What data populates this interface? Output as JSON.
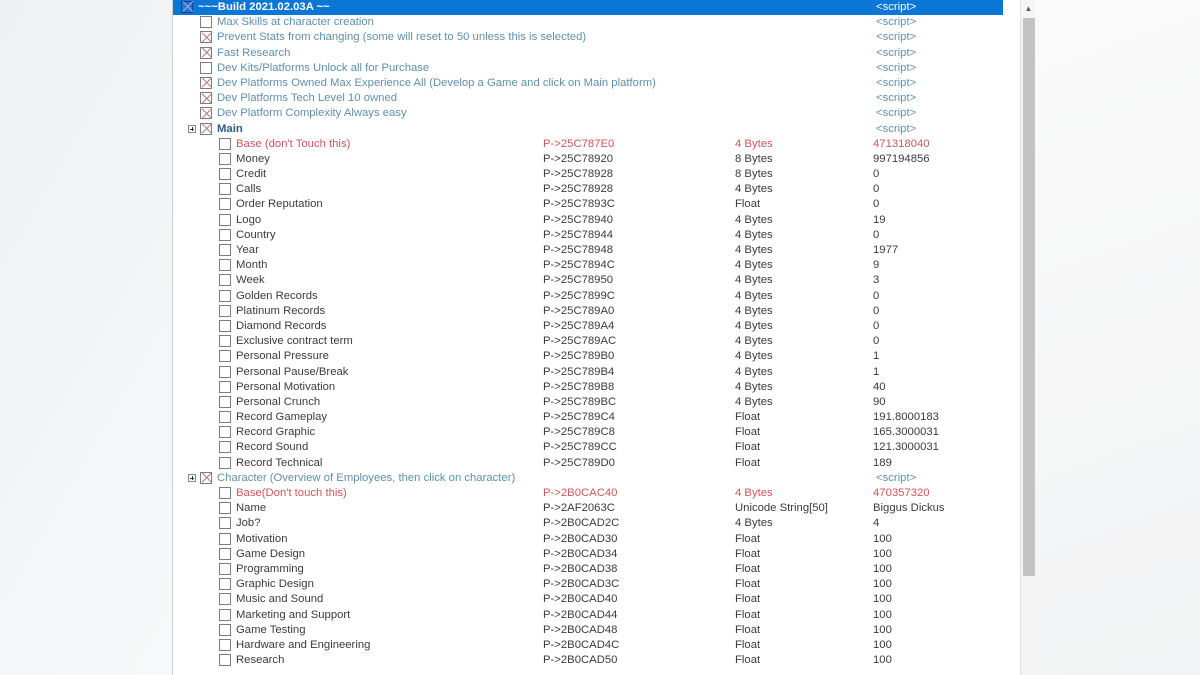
{
  "window": {
    "title": "Cheat Engine cheat table",
    "accent": "#0a76d6",
    "warn_color": "#d0555b",
    "desc_color": "#5f8fae"
  },
  "scrollbar": {
    "up_arrow_icon": "scroll-up-arrow",
    "up_arrow_glyph": "▲"
  },
  "table": {
    "script_cell_label": "<script>",
    "rows": [
      {
        "indent": 0,
        "expander": false,
        "checkbox": "checked",
        "selected": true,
        "desc": "~~~Build 2021.02.03A ~~",
        "style": "hdr-bold",
        "address": "",
        "type": "",
        "value": "",
        "script": "<script>"
      },
      {
        "indent": 1,
        "expander": false,
        "checkbox": "empty",
        "selected": false,
        "desc": "Max Skills at character creation",
        "style": "link",
        "address": "",
        "type": "",
        "value": "",
        "script": "<script>"
      },
      {
        "indent": 1,
        "expander": false,
        "checkbox": "checked",
        "selected": false,
        "desc": "Prevent Stats from changing (some will reset to 50 unless this is selected)",
        "style": "link",
        "address": "",
        "type": "",
        "value": "",
        "script": "<script>"
      },
      {
        "indent": 1,
        "expander": false,
        "checkbox": "checked",
        "selected": false,
        "desc": "Fast Research",
        "style": "link",
        "address": "",
        "type": "",
        "value": "",
        "script": "<script>"
      },
      {
        "indent": 1,
        "expander": false,
        "checkbox": "empty",
        "selected": false,
        "desc": "Dev Kits/Platforms Unlock all for Purchase",
        "style": "link",
        "address": "",
        "type": "",
        "value": "",
        "script": "<script>"
      },
      {
        "indent": 1,
        "expander": false,
        "checkbox": "checked",
        "selected": false,
        "desc": "Dev Platforms Owned Max Experience All  (Develop a Game and click on Main platform)",
        "style": "link",
        "address": "",
        "type": "",
        "value": "",
        "script": "<script>"
      },
      {
        "indent": 1,
        "expander": false,
        "checkbox": "checked",
        "selected": false,
        "desc": "Dev Platforms Tech Level 10 owned",
        "style": "link",
        "address": "",
        "type": "",
        "value": "",
        "script": "<script>"
      },
      {
        "indent": 1,
        "expander": false,
        "checkbox": "checked",
        "selected": false,
        "desc": "Dev Platform Complexity Always easy",
        "style": "link",
        "address": "",
        "type": "",
        "value": "",
        "script": "<script>"
      },
      {
        "indent": 1,
        "expander": true,
        "checkbox": "checked",
        "selected": false,
        "desc": "Main",
        "style": "hdr",
        "address": "",
        "type": "",
        "value": "",
        "script": "<script>"
      },
      {
        "indent": 2,
        "expander": false,
        "checkbox": "empty",
        "selected": false,
        "desc": "Base (don't Touch this)",
        "style": "warn",
        "address": "P->25C787E0",
        "type": "4 Bytes",
        "value": "471318040",
        "script": ""
      },
      {
        "indent": 2,
        "expander": false,
        "checkbox": "empty",
        "selected": false,
        "desc": "Money",
        "style": "plain",
        "address": "P->25C78920",
        "type": "8 Bytes",
        "value": "997194856",
        "script": ""
      },
      {
        "indent": 2,
        "expander": false,
        "checkbox": "empty",
        "selected": false,
        "desc": "Credit",
        "style": "plain",
        "address": "P->25C78928",
        "type": "8 Bytes",
        "value": "0",
        "script": ""
      },
      {
        "indent": 2,
        "expander": false,
        "checkbox": "empty",
        "selected": false,
        "desc": "Calls",
        "style": "plain",
        "address": "P->25C78928",
        "type": "4 Bytes",
        "value": "0",
        "script": ""
      },
      {
        "indent": 2,
        "expander": false,
        "checkbox": "empty",
        "selected": false,
        "desc": "Order Reputation",
        "style": "plain",
        "address": "P->25C7893C",
        "type": "Float",
        "value": "0",
        "script": ""
      },
      {
        "indent": 2,
        "expander": false,
        "checkbox": "empty",
        "selected": false,
        "desc": "Logo",
        "style": "plain",
        "address": "P->25C78940",
        "type": "4 Bytes",
        "value": "19",
        "script": ""
      },
      {
        "indent": 2,
        "expander": false,
        "checkbox": "empty",
        "selected": false,
        "desc": "Country",
        "style": "plain",
        "address": "P->25C78944",
        "type": "4 Bytes",
        "value": "0",
        "script": ""
      },
      {
        "indent": 2,
        "expander": false,
        "checkbox": "empty",
        "selected": false,
        "desc": "Year",
        "style": "plain",
        "address": "P->25C78948",
        "type": "4 Bytes",
        "value": "1977",
        "script": ""
      },
      {
        "indent": 2,
        "expander": false,
        "checkbox": "empty",
        "selected": false,
        "desc": "Month",
        "style": "plain",
        "address": "P->25C7894C",
        "type": "4 Bytes",
        "value": "9",
        "script": ""
      },
      {
        "indent": 2,
        "expander": false,
        "checkbox": "empty",
        "selected": false,
        "desc": "Week",
        "style": "plain",
        "address": "P->25C78950",
        "type": "4 Bytes",
        "value": "3",
        "script": ""
      },
      {
        "indent": 2,
        "expander": false,
        "checkbox": "empty",
        "selected": false,
        "desc": "Golden Records",
        "style": "plain",
        "address": "P->25C7899C",
        "type": "4 Bytes",
        "value": "0",
        "script": ""
      },
      {
        "indent": 2,
        "expander": false,
        "checkbox": "empty",
        "selected": false,
        "desc": "Platinum Records",
        "style": "plain",
        "address": "P->25C789A0",
        "type": "4 Bytes",
        "value": "0",
        "script": ""
      },
      {
        "indent": 2,
        "expander": false,
        "checkbox": "empty",
        "selected": false,
        "desc": "Diamond Records",
        "style": "plain",
        "address": "P->25C789A4",
        "type": "4 Bytes",
        "value": "0",
        "script": ""
      },
      {
        "indent": 2,
        "expander": false,
        "checkbox": "empty",
        "selected": false,
        "desc": "Exclusive contract term",
        "style": "plain",
        "address": "P->25C789AC",
        "type": "4 Bytes",
        "value": "0",
        "script": ""
      },
      {
        "indent": 2,
        "expander": false,
        "checkbox": "empty",
        "selected": false,
        "desc": "Personal Pressure",
        "style": "plain",
        "address": "P->25C789B0",
        "type": "4 Bytes",
        "value": "1",
        "script": ""
      },
      {
        "indent": 2,
        "expander": false,
        "checkbox": "empty",
        "selected": false,
        "desc": "Personal Pause/Break",
        "style": "plain",
        "address": "P->25C789B4",
        "type": "4 Bytes",
        "value": "1",
        "script": ""
      },
      {
        "indent": 2,
        "expander": false,
        "checkbox": "empty",
        "selected": false,
        "desc": "Personal Motivation",
        "style": "plain",
        "address": "P->25C789B8",
        "type": "4 Bytes",
        "value": "40",
        "script": ""
      },
      {
        "indent": 2,
        "expander": false,
        "checkbox": "empty",
        "selected": false,
        "desc": "Personal Crunch",
        "style": "plain",
        "address": "P->25C789BC",
        "type": "4 Bytes",
        "value": "90",
        "script": ""
      },
      {
        "indent": 2,
        "expander": false,
        "checkbox": "empty",
        "selected": false,
        "desc": "Record Gameplay",
        "style": "plain",
        "address": "P->25C789C4",
        "type": "Float",
        "value": "191.8000183",
        "script": ""
      },
      {
        "indent": 2,
        "expander": false,
        "checkbox": "empty",
        "selected": false,
        "desc": "Record Graphic",
        "style": "plain",
        "address": "P->25C789C8",
        "type": "Float",
        "value": "165.3000031",
        "script": ""
      },
      {
        "indent": 2,
        "expander": false,
        "checkbox": "empty",
        "selected": false,
        "desc": "Record Sound",
        "style": "plain",
        "address": "P->25C789CC",
        "type": "Float",
        "value": "121.3000031",
        "script": ""
      },
      {
        "indent": 2,
        "expander": false,
        "checkbox": "empty",
        "selected": false,
        "desc": "Record Technical",
        "style": "plain",
        "address": "P->25C789D0",
        "type": "Float",
        "value": "189",
        "script": ""
      },
      {
        "indent": 1,
        "expander": true,
        "checkbox": "checked",
        "selected": false,
        "desc": "Character (Overview of Employees, then click on character)",
        "style": "link",
        "address": "",
        "type": "",
        "value": "",
        "script": "<script>"
      },
      {
        "indent": 2,
        "expander": false,
        "checkbox": "empty",
        "selected": false,
        "desc": "Base(Don't touch this)",
        "style": "warn",
        "address": "P->2B0CAC40",
        "type": "4 Bytes",
        "value": "470357320",
        "script": ""
      },
      {
        "indent": 2,
        "expander": false,
        "checkbox": "empty",
        "selected": false,
        "desc": "Name",
        "style": "plain",
        "address": "P->2AF2063C",
        "type": "Unicode String[50]",
        "value": "Biggus Dickus",
        "script": ""
      },
      {
        "indent": 2,
        "expander": false,
        "checkbox": "empty",
        "selected": false,
        "desc": "Job?",
        "style": "plain",
        "address": "P->2B0CAD2C",
        "type": "4 Bytes",
        "value": "4",
        "script": ""
      },
      {
        "indent": 2,
        "expander": false,
        "checkbox": "empty",
        "selected": false,
        "desc": "Motivation",
        "style": "plain",
        "address": "P->2B0CAD30",
        "type": "Float",
        "value": "100",
        "script": ""
      },
      {
        "indent": 2,
        "expander": false,
        "checkbox": "empty",
        "selected": false,
        "desc": "Game Design",
        "style": "plain",
        "address": "P->2B0CAD34",
        "type": "Float",
        "value": "100",
        "script": ""
      },
      {
        "indent": 2,
        "expander": false,
        "checkbox": "empty",
        "selected": false,
        "desc": "Programming",
        "style": "plain",
        "address": "P->2B0CAD38",
        "type": "Float",
        "value": "100",
        "script": ""
      },
      {
        "indent": 2,
        "expander": false,
        "checkbox": "empty",
        "selected": false,
        "desc": "Graphic Design",
        "style": "plain",
        "address": "P->2B0CAD3C",
        "type": "Float",
        "value": "100",
        "script": ""
      },
      {
        "indent": 2,
        "expander": false,
        "checkbox": "empty",
        "selected": false,
        "desc": "Music and Sound",
        "style": "plain",
        "address": "P->2B0CAD40",
        "type": "Float",
        "value": "100",
        "script": ""
      },
      {
        "indent": 2,
        "expander": false,
        "checkbox": "empty",
        "selected": false,
        "desc": "Marketing and Support",
        "style": "plain",
        "address": "P->2B0CAD44",
        "type": "Float",
        "value": "100",
        "script": ""
      },
      {
        "indent": 2,
        "expander": false,
        "checkbox": "empty",
        "selected": false,
        "desc": "Game Testing",
        "style": "plain",
        "address": "P->2B0CAD48",
        "type": "Float",
        "value": "100",
        "script": ""
      },
      {
        "indent": 2,
        "expander": false,
        "checkbox": "empty",
        "selected": false,
        "desc": "Hardware and Engineering",
        "style": "plain",
        "address": "P->2B0CAD4C",
        "type": "Float",
        "value": "100",
        "script": ""
      },
      {
        "indent": 2,
        "expander": false,
        "checkbox": "empty",
        "selected": false,
        "desc": "Research",
        "style": "plain",
        "address": "P->2B0CAD50",
        "type": "Float",
        "value": "100",
        "script": ""
      }
    ]
  }
}
